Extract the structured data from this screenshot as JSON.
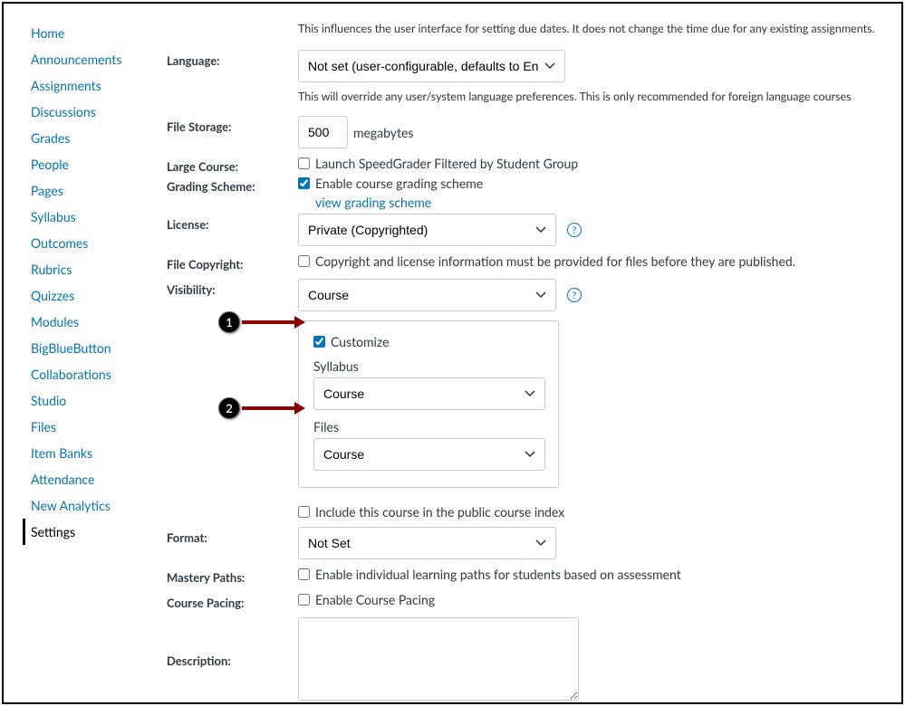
{
  "sidebar": {
    "items": [
      {
        "label": "Home"
      },
      {
        "label": "Announcements"
      },
      {
        "label": "Assignments"
      },
      {
        "label": "Discussions"
      },
      {
        "label": "Grades"
      },
      {
        "label": "People"
      },
      {
        "label": "Pages"
      },
      {
        "label": "Syllabus"
      },
      {
        "label": "Outcomes"
      },
      {
        "label": "Rubrics"
      },
      {
        "label": "Quizzes"
      },
      {
        "label": "Modules"
      },
      {
        "label": "BigBlueButton"
      },
      {
        "label": "Collaborations"
      },
      {
        "label": "Studio"
      },
      {
        "label": "Files"
      },
      {
        "label": "Item Banks"
      },
      {
        "label": "Attendance"
      },
      {
        "label": "New Analytics"
      },
      {
        "label": "Settings"
      }
    ]
  },
  "settings": {
    "top_hint": "This influences the user interface for setting due dates. It does not change the time due for any existing assignments.",
    "language": {
      "label": "Language:",
      "value": "Not set (user-configurable, defaults to English (United States))",
      "hint": "This will override any user/system language preferences. This is only recommended for foreign language courses"
    },
    "file_storage": {
      "label": "File Storage:",
      "value": "500",
      "unit": "megabytes"
    },
    "large_course": {
      "label": "Large Course:",
      "checkbox_label": "Launch SpeedGrader Filtered by Student Group"
    },
    "grading_scheme": {
      "label": "Grading Scheme:",
      "checkbox_label": "Enable course grading scheme",
      "link": "view grading scheme"
    },
    "license": {
      "label": "License:",
      "value": "Private (Copyrighted)"
    },
    "file_copyright": {
      "label": "File Copyright:",
      "checkbox_label": "Copyright and license information must be provided for files before they are published."
    },
    "visibility": {
      "label": "Visibility:",
      "value": "Course",
      "customize": {
        "checkbox_label": "Customize",
        "syllabus_label": "Syllabus",
        "syllabus_value": "Course",
        "files_label": "Files",
        "files_value": "Course"
      },
      "public_index_label": "Include this course in the public course index"
    },
    "format": {
      "label": "Format:",
      "value": "Not Set"
    },
    "mastery_paths": {
      "label": "Mastery Paths:",
      "checkbox_label": "Enable individual learning paths for students based on assessment"
    },
    "course_pacing": {
      "label": "Course Pacing:",
      "checkbox_label": "Enable Course Pacing"
    },
    "description": {
      "label": "Description:"
    }
  },
  "annotations": {
    "a1": "1",
    "a2": "2"
  }
}
